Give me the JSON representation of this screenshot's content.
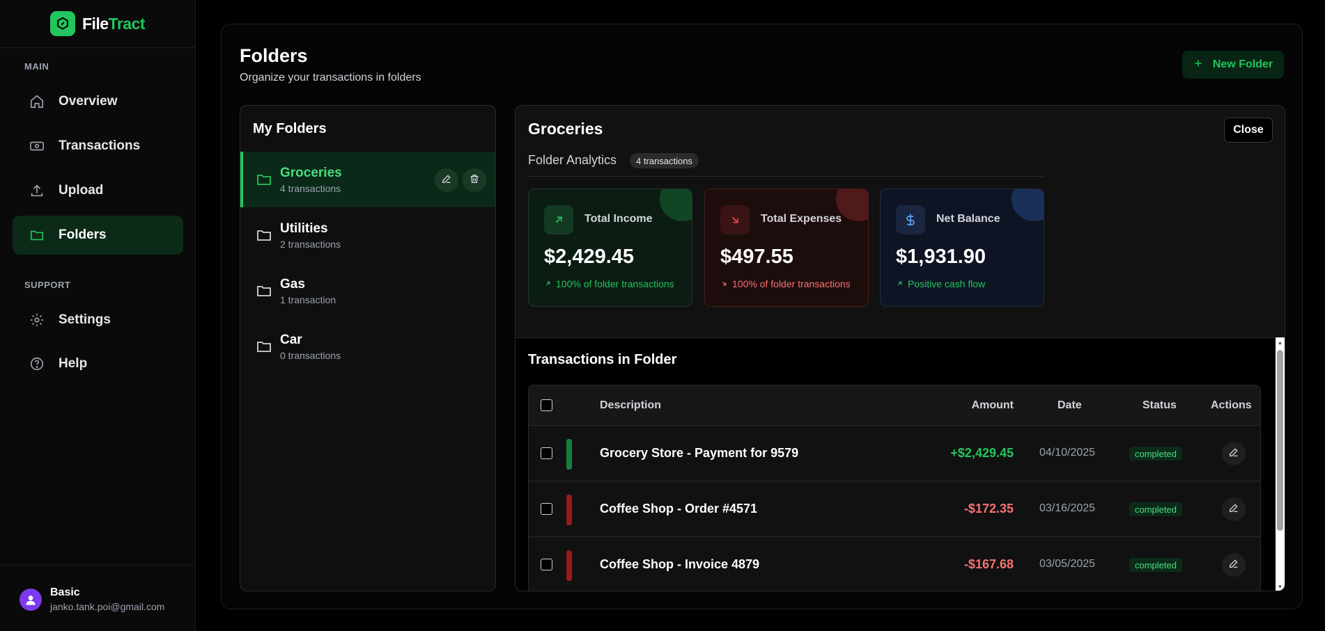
{
  "brand": {
    "name_part1": "File",
    "name_part2": "Tract"
  },
  "sidebar": {
    "main_label": "MAIN",
    "support_label": "SUPPORT",
    "items": [
      {
        "label": "Overview",
        "icon": "home-icon"
      },
      {
        "label": "Transactions",
        "icon": "banknote-icon"
      },
      {
        "label": "Upload",
        "icon": "upload-icon"
      },
      {
        "label": "Folders",
        "icon": "folder-icon"
      },
      {
        "label": "Settings",
        "icon": "gear-icon"
      },
      {
        "label": "Help",
        "icon": "help-circle-icon"
      }
    ],
    "active": "Folders",
    "user": {
      "plan": "Basic",
      "email": "janko.tank.poi@gmail.com"
    }
  },
  "page": {
    "title": "Folders",
    "subtitle": "Organize your transactions in folders",
    "new_folder_label": "New Folder"
  },
  "folders": {
    "title": "My Folders",
    "items": [
      {
        "name": "Groceries",
        "count": "4 transactions"
      },
      {
        "name": "Utilities",
        "count": "2 transactions"
      },
      {
        "name": "Gas",
        "count": "1 transaction"
      },
      {
        "name": "Car",
        "count": "0 transactions"
      }
    ],
    "selected": "Groceries"
  },
  "detail": {
    "title": "Groceries",
    "close_label": "Close",
    "analytics_label": "Folder Analytics",
    "analytics_badge": "4 transactions",
    "stats": {
      "income": {
        "label": "Total Income",
        "value": "$2,429.45",
        "note": "100% of folder transactions",
        "color": "#22c55e"
      },
      "expense": {
        "label": "Total Expenses",
        "value": "$497.55",
        "note": "100% of folder transactions",
        "color": "#ef4444"
      },
      "balance": {
        "label": "Net Balance",
        "value": "$1,931.90",
        "note": "Positive cash flow",
        "color": "#3b82f6"
      }
    },
    "transactions": {
      "title": "Transactions in Folder",
      "headers": {
        "description": "Description",
        "amount": "Amount",
        "date": "Date",
        "status": "Status",
        "actions": "Actions"
      },
      "rows": [
        {
          "description": "Grocery Store - Payment for 9579",
          "amount": "+$2,429.45",
          "date": "04/10/2025",
          "status": "completed",
          "type": "income"
        },
        {
          "description": "Coffee Shop - Order #4571",
          "amount": "-$172.35",
          "date": "03/16/2025",
          "status": "completed",
          "type": "expense"
        },
        {
          "description": "Coffee Shop - Invoice 4879",
          "amount": "-$167.68",
          "date": "03/05/2025",
          "status": "completed",
          "type": "expense"
        }
      ]
    }
  }
}
